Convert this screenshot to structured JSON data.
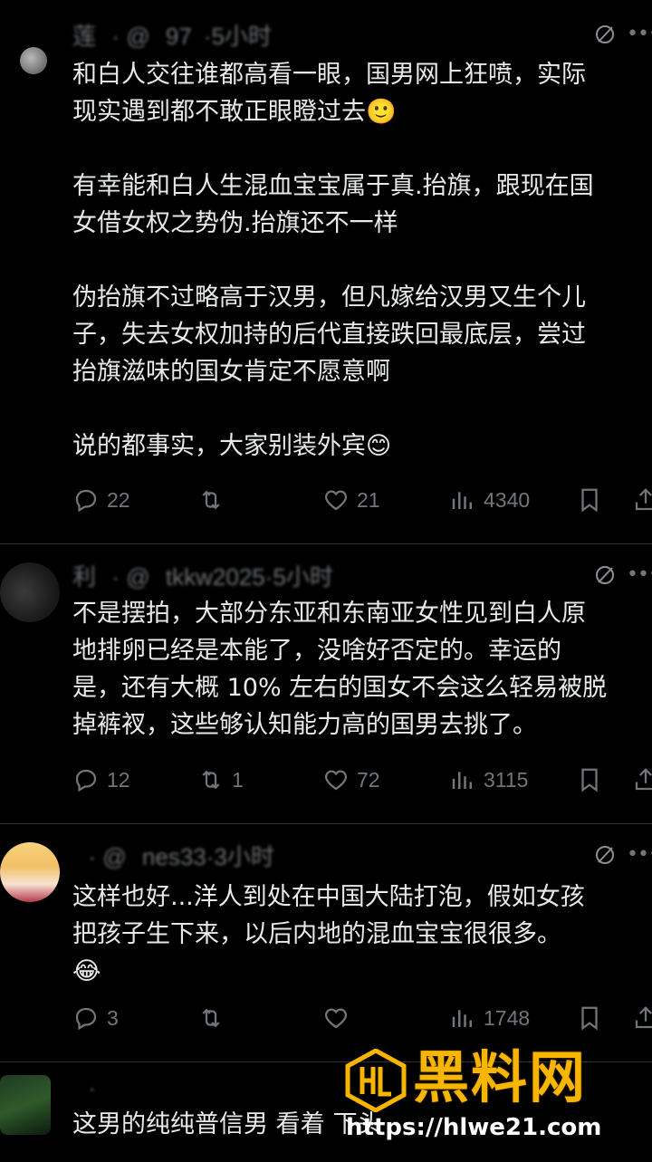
{
  "posts": [
    {
      "handle": "莲    · @    97   ·5小时",
      "lines": [
        "和白人交往谁都高看一眼，国男网上狂喷，实际",
        "现实遇到都不敢正眼瞪过去🙂",
        "",
        "有幸能和白人生混血宝宝属于真.抬旗，跟现在国",
        "女借女权之势伪.抬旗还不一样",
        "",
        "伪抬旗不过略高于汉男，但凡嫁给汉男又生个儿",
        "子，失去女权加持的后代直接跌回最底层，尝过",
        "抬旗滋味的国女肯定不愿意啊",
        "",
        "说的都事实，大家别装外宾😊"
      ],
      "replies": "22",
      "reposts": "",
      "likes": "21",
      "views": "4340"
    },
    {
      "handle": "利    · @    tkkw2025·5小时",
      "lines": [
        "不是摆拍，大部分东亚和东南亚女性见到白人原",
        "地排卵已经是本能了，没啥好否定的。幸运的",
        "是，还有大概 10% 左右的国女不会这么轻易被脱",
        "掉裤衩，这些够认知能力高的国男去挑了。"
      ],
      "replies": "12",
      "reposts": "1",
      "likes": "72",
      "views": "3115"
    },
    {
      "handle": "    · @    nes33·3小时",
      "lines": [
        "这样也好...洋人到处在中国大陆打泡，假如女孩",
        "把孩子生下来，以后内地的混血宝宝很很多。",
        "😂"
      ],
      "replies": "3",
      "reposts": "",
      "likes": "",
      "views": "1748"
    },
    {
      "handle": "    ·    ",
      "lines": [
        "这男的纯纯普信男 看着  下头"
      ]
    }
  ],
  "icons": {
    "reply": "reply-icon",
    "repost": "repost-icon",
    "like": "heart-icon",
    "views": "views-icon",
    "bookmark": "bookmark-icon",
    "share": "share-icon",
    "grok": "grok-icon",
    "more": "more-icon"
  },
  "watermark": {
    "title": "黑料网",
    "url": "https://hlwe21.com"
  },
  "colors": {
    "background": "#000000",
    "text": "#e7e9ea",
    "muted": "#71767b",
    "watermark": "#f7b500"
  }
}
